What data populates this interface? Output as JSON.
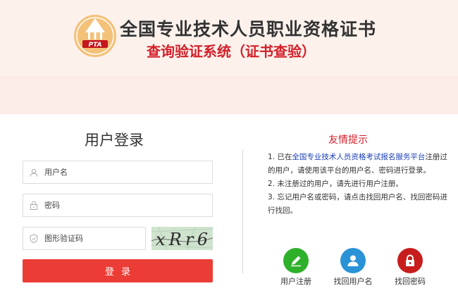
{
  "header": {
    "logo_text": "PTA",
    "title": "全国专业技术人员职业资格证书",
    "subtitle": "查询验证系统（证书查验）"
  },
  "login": {
    "title": "用户登录",
    "username_placeholder": "用户名",
    "password_placeholder": "密码",
    "captcha_placeholder": "图形验证码",
    "captcha_text": "xRr6",
    "submit_label": "登录"
  },
  "tips": {
    "title": "友情提示",
    "item1_prefix": "1. 已在",
    "item1_link": "全国专业技术人员资格考试报名服务平台",
    "item1_suffix": "注册过的用户，请使用该平台的用户名、密码进行登录。",
    "item2": "2. 未注册过的用户，请先进行用户注册。",
    "item3": "3. 忘记用户名或密码，请点击找回用户名、找回密码进行找回。"
  },
  "shortcuts": [
    {
      "label": "用户注册",
      "color": "#2fb02b",
      "icon": "pencil-icon"
    },
    {
      "label": "找回用户名",
      "color": "#2a92d6",
      "icon": "user-icon"
    },
    {
      "label": "找回密码",
      "color": "#c81d1d",
      "icon": "lock-icon"
    }
  ]
}
